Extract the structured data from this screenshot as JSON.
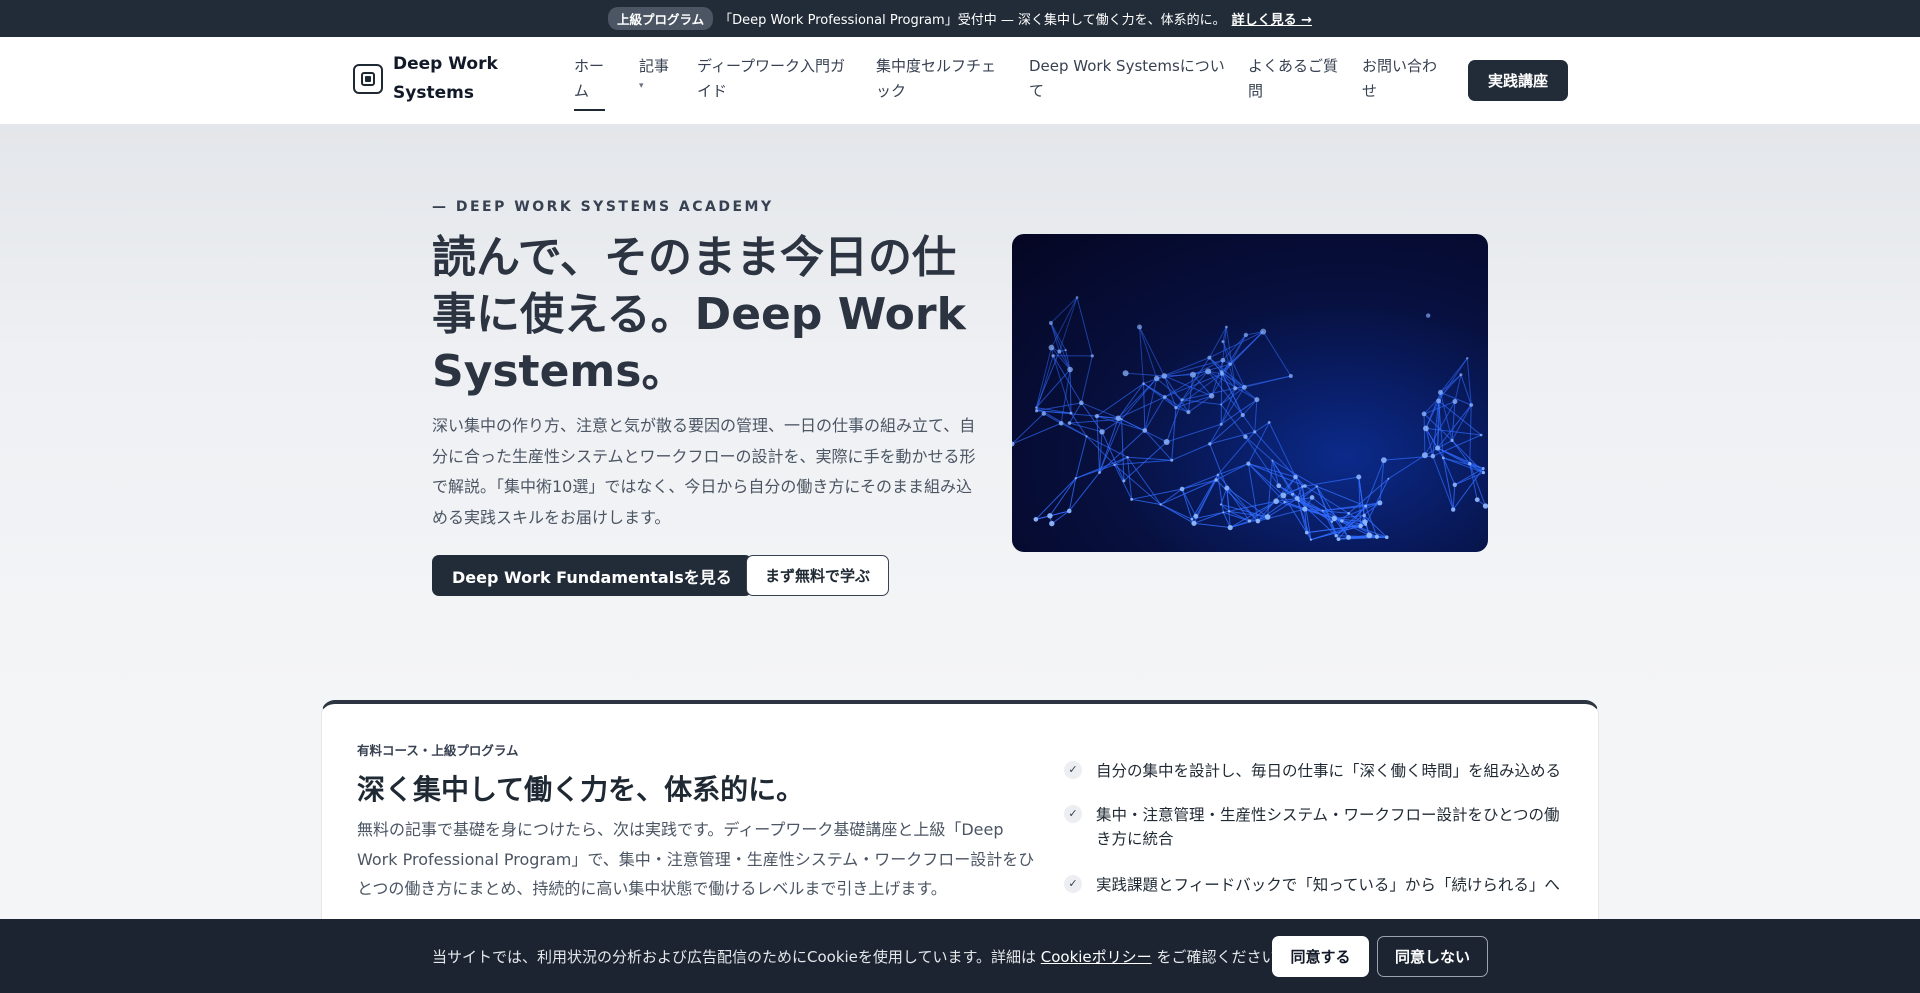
{
  "announcement": {
    "badge": "上級プログラム",
    "text": "「Deep Work Professional Program」受付中 — 深く集中して働く力を、体系的に。",
    "link": "詳しく見る →"
  },
  "header": {
    "logo_text": "Deep Work Systems",
    "nav": [
      {
        "label": "ホーム"
      },
      {
        "label": "記事",
        "caret": "▾"
      },
      {
        "label": "ディープワーク入門ガイド"
      },
      {
        "label": "集中度セルフチェック"
      },
      {
        "label": "Deep Work Systemsについて"
      },
      {
        "label": "よくあるご質問"
      },
      {
        "label": "お問い合わせ"
      }
    ],
    "cta": "実践講座"
  },
  "hero": {
    "eyebrow": "— DEEP WORK SYSTEMS ACADEMY",
    "title": "読んで、そのまま今日の仕事に使える。Deep Work Systems。",
    "description": "深い集中の作り方、注意と気が散る要因の管理、一日の仕事の組み立て、自分に合った生産性システムとワークフローの設計を、実際に手を動かせる形で解説。「集中術10選」ではなく、今日から自分の働き方にそのまま組み込める実践スキルをお届けします。",
    "primary_button": "Deep Work Fundamentalsを見る",
    "secondary_button": "まず無料で学ぶ"
  },
  "course": {
    "label": "有料コース・上級プログラム",
    "title": "深く集中して働く力を、体系的に。",
    "description": "無料の記事で基礎を身につけたら、次は実践です。ディープワーク基礎講座と上級「Deep Work Professional Program」で、集中・注意管理・生産性システム・ワークフロー設計をひとつの働き方にまとめ、持続的に高い集中状態で働けるレベルまで引き上げます。",
    "check_glyph": "✓",
    "features": [
      "自分の集中を設計し、毎日の仕事に「深く働く時間」を組み込める",
      "集中・注意管理・生産性システム・ワークフロー設計をひとつの働き方に統合",
      "実践課題とフィードバックで「知っている」から「続けられる」へ"
    ]
  },
  "cookie": {
    "text_before": "当サイトでは、利用状況の分析および広告配信のためにCookieを使用しています。詳細は",
    "link": "Cookieポリシー",
    "text_after": "をご確認ください。",
    "accept": "同意する",
    "reject": "同意しない"
  },
  "colors": {
    "dark": "#222c38",
    "image_glow": "#2f6bff"
  }
}
